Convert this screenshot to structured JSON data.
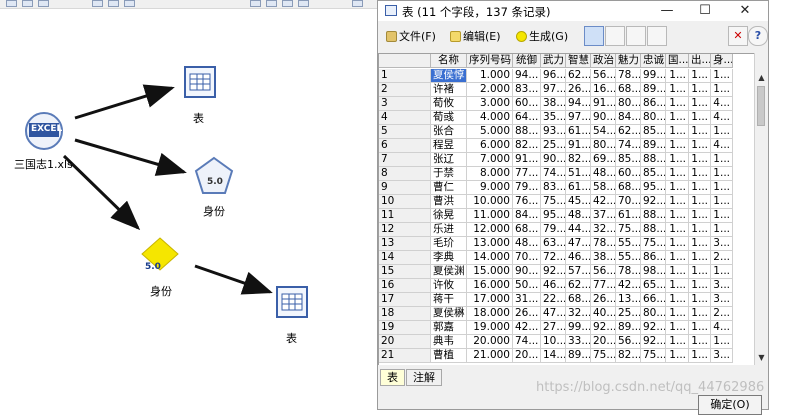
{
  "canvas": {
    "excel_node_label": "三国志1.xls",
    "excel_icon_text": "EXCEL",
    "table_node_top_label": "表",
    "identity_node_top_label": "身份",
    "identity_node_diamond_label": "身份",
    "table_node_bottom_label": "表",
    "version_badge": "5.0"
  },
  "window": {
    "title": "表 (11 个字段，137 条记录)",
    "minimize": "—",
    "maximize": "☐",
    "close": "✕"
  },
  "menu": {
    "file": "文件(F)",
    "edit": "编辑(E)",
    "generate": "生成(G)"
  },
  "table": {
    "columns": [
      "名称",
      "序列号码",
      "统御",
      "武力",
      "智慧",
      "政治",
      "魅力",
      "忠诚",
      "国...",
      "出...",
      "身..."
    ],
    "rows": [
      [
        "1",
        "夏侯惇",
        "1.000",
        "94...",
        "96...",
        "62...",
        "56...",
        "78...",
        "99...",
        "1...",
        "1...",
        "1..."
      ],
      [
        "2",
        "许褚",
        "2.000",
        "83...",
        "97...",
        "26...",
        "16...",
        "68...",
        "89...",
        "1...",
        "1...",
        "1..."
      ],
      [
        "3",
        "荀攸",
        "3.000",
        "60...",
        "38...",
        "94...",
        "91...",
        "80...",
        "86...",
        "1...",
        "1...",
        "4..."
      ],
      [
        "4",
        "荀彧",
        "4.000",
        "64...",
        "35...",
        "97...",
        "90...",
        "84...",
        "80...",
        "1...",
        "1...",
        "4..."
      ],
      [
        "5",
        "张合",
        "5.000",
        "88...",
        "93...",
        "61...",
        "54...",
        "62...",
        "85...",
        "1...",
        "1...",
        "1..."
      ],
      [
        "6",
        "程昱",
        "6.000",
        "82...",
        "25...",
        "91...",
        "80...",
        "74...",
        "89...",
        "1...",
        "1...",
        "4..."
      ],
      [
        "7",
        "张辽",
        "7.000",
        "91...",
        "90...",
        "82...",
        "69...",
        "85...",
        "88...",
        "1...",
        "1...",
        "1..."
      ],
      [
        "8",
        "于禁",
        "8.000",
        "77...",
        "74...",
        "51...",
        "48...",
        "60...",
        "85...",
        "1...",
        "1...",
        "1..."
      ],
      [
        "9",
        "曹仁",
        "9.000",
        "79...",
        "83...",
        "61...",
        "58...",
        "68...",
        "95...",
        "1...",
        "1...",
        "1..."
      ],
      [
        "10",
        "曹洪",
        "10.000",
        "76...",
        "75...",
        "45...",
        "42...",
        "70...",
        "92...",
        "1...",
        "1...",
        "1..."
      ],
      [
        "11",
        "徐晃",
        "11.000",
        "84...",
        "95...",
        "48...",
        "37...",
        "61...",
        "88...",
        "1...",
        "1...",
        "1..."
      ],
      [
        "12",
        "乐进",
        "12.000",
        "68...",
        "79...",
        "44...",
        "32...",
        "75...",
        "88...",
        "1...",
        "1...",
        "1..."
      ],
      [
        "13",
        "毛玠",
        "13.000",
        "48...",
        "63...",
        "47...",
        "78...",
        "55...",
        "75...",
        "1...",
        "1...",
        "3..."
      ],
      [
        "14",
        "李典",
        "14.000",
        "70...",
        "72...",
        "46...",
        "38...",
        "55...",
        "86...",
        "1...",
        "1...",
        "2..."
      ],
      [
        "15",
        "夏侯渊",
        "15.000",
        "90...",
        "92...",
        "57...",
        "56...",
        "78...",
        "98...",
        "1...",
        "1...",
        "1..."
      ],
      [
        "16",
        "许攸",
        "16.000",
        "50...",
        "46...",
        "62...",
        "77...",
        "42...",
        "65...",
        "1...",
        "1...",
        "3..."
      ],
      [
        "17",
        "蒋干",
        "17.000",
        "31...",
        "22...",
        "68...",
        "26...",
        "13...",
        "66...",
        "1...",
        "1...",
        "3..."
      ],
      [
        "18",
        "夏侯楙",
        "18.000",
        "26...",
        "47...",
        "32...",
        "40...",
        "25...",
        "80...",
        "1...",
        "1...",
        "2..."
      ],
      [
        "19",
        "郭嘉",
        "19.000",
        "42...",
        "27...",
        "99...",
        "92...",
        "89...",
        "92...",
        "1...",
        "1...",
        "4..."
      ],
      [
        "20",
        "典韦",
        "20.000",
        "74...",
        "10...",
        "33...",
        "20...",
        "56...",
        "92...",
        "1...",
        "1...",
        "1..."
      ],
      [
        "21",
        "曹植",
        "21.000",
        "20...",
        "14...",
        "89...",
        "75...",
        "82...",
        "75...",
        "1...",
        "1...",
        "3..."
      ]
    ]
  },
  "tabs": [
    "表",
    "注解"
  ],
  "ok_button": "确定(O)",
  "watermark": "https://blog.csdn.net/qq_44762986",
  "colors": {
    "selection": "#3a6fd1",
    "arrow": "#111111",
    "identity_diamond": "#f5e600",
    "table_icon_border": "#3a5fa8"
  }
}
